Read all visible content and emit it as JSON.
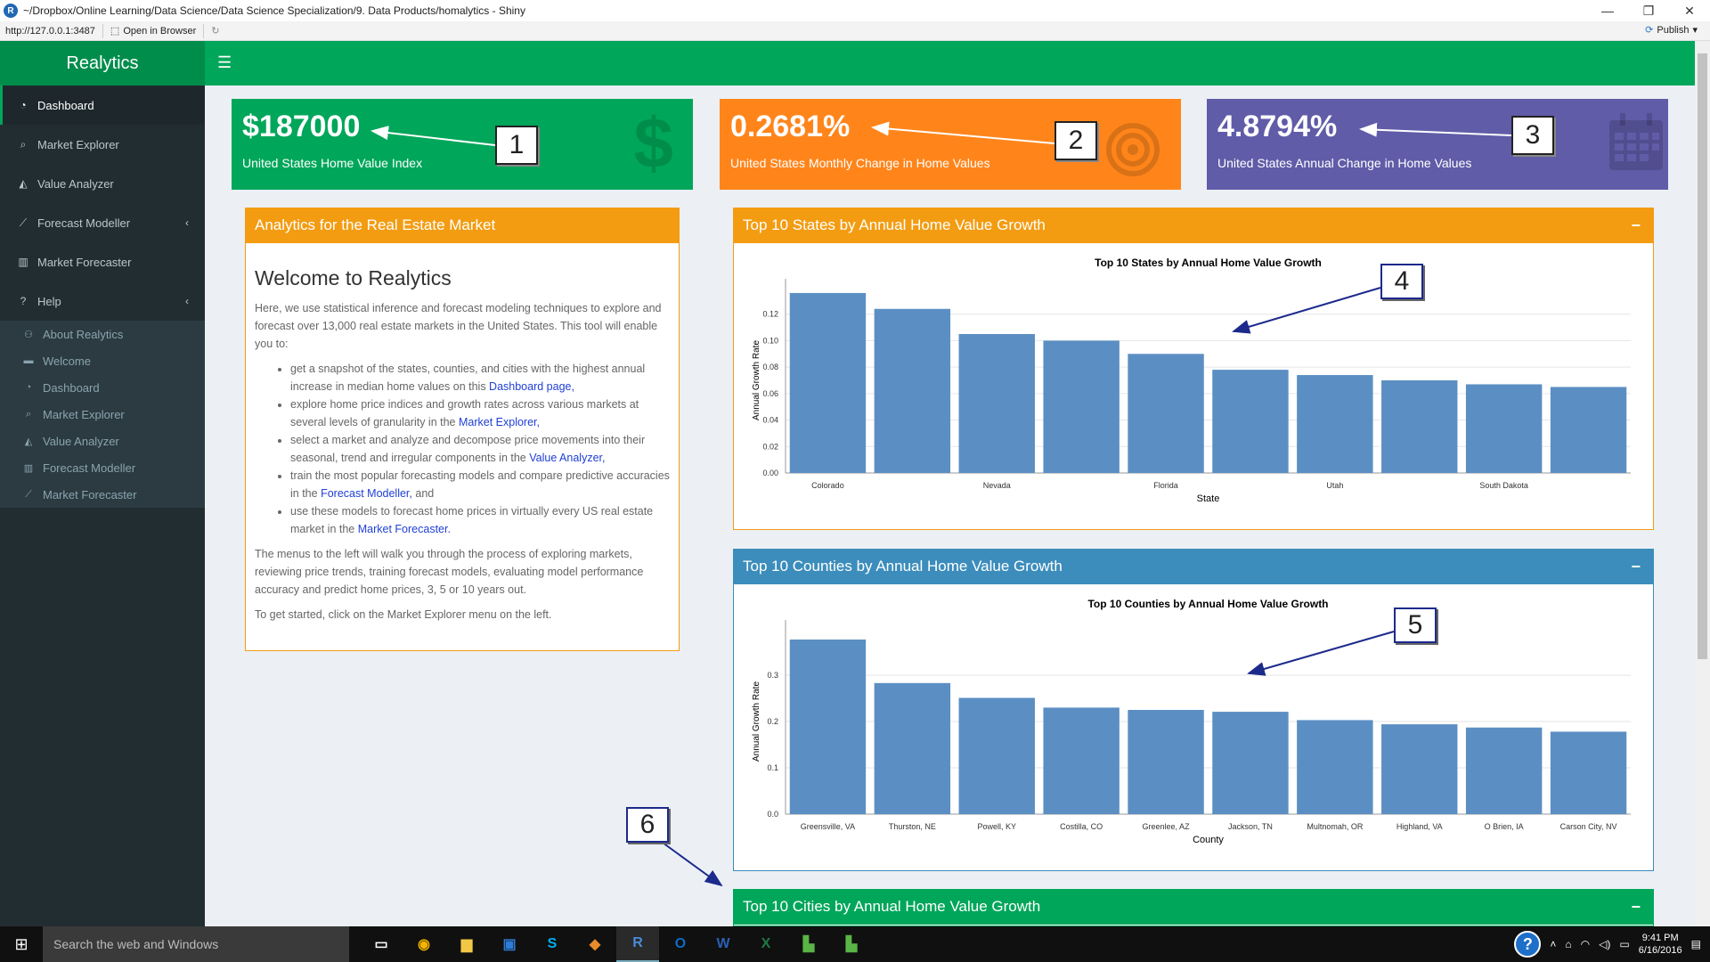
{
  "window": {
    "title": "~/Dropbox/Online Learning/Data Science/Data Science Specialization/9. Data Products/homalytics - Shiny",
    "address": "http://127.0.0.1:3487",
    "open_in_browser": "Open in Browser",
    "publish": "Publish"
  },
  "app": {
    "brand": "Realytics",
    "sidebar": {
      "items": [
        {
          "label": "Dashboard",
          "icon": "dashboard-icon"
        },
        {
          "label": "Market Explorer",
          "icon": "search-icon"
        },
        {
          "label": "Value Analyzer",
          "icon": "area-chart-icon"
        },
        {
          "label": "Forecast Modeller",
          "icon": "line-chart-icon"
        },
        {
          "label": "Market Forecaster",
          "icon": "bar-chart-icon"
        },
        {
          "label": "Help",
          "icon": "question-circle-icon"
        }
      ],
      "help_subitems": [
        {
          "label": "About Realytics",
          "icon": "users-icon"
        },
        {
          "label": "Welcome",
          "icon": "keyboard-icon"
        },
        {
          "label": "Dashboard",
          "icon": "dashboard-icon"
        },
        {
          "label": "Market Explorer",
          "icon": "search-icon"
        },
        {
          "label": "Value Analyzer",
          "icon": "area-chart-icon"
        },
        {
          "label": "Forecast Modeller",
          "icon": "bar-chart-icon"
        },
        {
          "label": "Market Forecaster",
          "icon": "line-chart-icon"
        }
      ]
    },
    "info_boxes": [
      {
        "value": "$187000",
        "label": "United States Home Value Index",
        "color": "#00a65a",
        "icon": "dollar-icon"
      },
      {
        "value": "0.2681%",
        "label": "United States Monthly Change in Home Values",
        "color": "#ff851b",
        "icon": "bullseye-icon"
      },
      {
        "value": "4.8794%",
        "label": "United States Annual Change in Home Values",
        "color": "#605ca8",
        "icon": "calendar-icon"
      }
    ],
    "welcome_box": {
      "header": "Analytics for the Real Estate Market",
      "title": "Welcome to Realytics",
      "intro": "Here, we use statistical inference and forecast modeling techniques to explore and forecast over 13,000 real estate markets in the United States. This tool will enable you to:",
      "bullets": [
        {
          "text": "get a snapshot of the states, counties, and cities with the highest annual increase in median home values on this ",
          "link": "Dashboard page,",
          "after": ""
        },
        {
          "text": "explore home price indices and growth rates across various markets at several levels of granularity in the ",
          "link": "Market Explorer,",
          "after": ""
        },
        {
          "text": "select a market and analyze and decompose price movements into their seasonal, trend and irregular components in the ",
          "link": "Value Analyzer,",
          "after": ""
        },
        {
          "text": "train the most popular forecasting models and compare predictive accuracies in the ",
          "link": "Forecast Modeller,",
          "after": " and"
        },
        {
          "text": "use these models to forecast home prices in virtually every US real estate market in the ",
          "link": "Market Forecaster.",
          "after": ""
        }
      ],
      "para2": "The menus to the left will walk you through the process of exploring markets, reviewing price trends, training forecast models, evaluating model performance accuracy and predict home prices, 3, 5 or 10 years out.",
      "para3": "To get started, click on the Market Explorer menu on the left."
    },
    "states_box": {
      "header": "Top 10 States by Annual Home Value Growth",
      "collapse": "−"
    },
    "counties_box": {
      "header": "Top 10 Counties by Annual Home Value Growth",
      "collapse": "−"
    },
    "cities_box": {
      "header": "Top 10 Cities by Annual Home Value Growth",
      "collapse": "−"
    },
    "callouts": [
      "1",
      "2",
      "3",
      "4",
      "5",
      "6"
    ]
  },
  "chart_data": [
    {
      "type": "bar",
      "title": "Top 10 States by Annual Home Value Growth",
      "xlabel": "State",
      "ylabel": "Annual Growth Rate",
      "categories": [
        "Colorado",
        "",
        "Nevada",
        "",
        "Florida",
        "",
        "Utah",
        "",
        "South Dakota",
        ""
      ],
      "values": [
        0.136,
        0.124,
        0.105,
        0.1,
        0.09,
        0.078,
        0.074,
        0.07,
        0.067,
        0.065
      ],
      "yticks": [
        "0.00",
        "0.02",
        "0.04",
        "0.06",
        "0.08",
        "0.10",
        "0.12"
      ],
      "ylim": [
        0,
        0.14
      ],
      "color": "#5b8fc3",
      "grid": true
    },
    {
      "type": "bar",
      "title": "Top 10 Counties by Annual Home Value Growth",
      "xlabel": "County",
      "ylabel": "Annual Growth Rate",
      "categories": [
        "Greensville, VA",
        "Thurston, NE",
        "Powell, KY",
        "Costilla, CO",
        "Greenlee, AZ",
        "Jackson, TN",
        "Multnomah, OR",
        "Highland, VA",
        "O Brien, IA",
        "Carson City, NV"
      ],
      "values": [
        0.377,
        0.283,
        0.251,
        0.23,
        0.225,
        0.221,
        0.203,
        0.194,
        0.187,
        0.178
      ],
      "yticks": [
        "0.0",
        "0.1",
        "0.2",
        "0.3"
      ],
      "ylim": [
        0,
        0.4
      ],
      "color": "#5b8fc3",
      "grid": true
    }
  ],
  "taskbar": {
    "search": "Search the web and Windows",
    "time": "9:41 PM",
    "date": "6/16/2016"
  }
}
